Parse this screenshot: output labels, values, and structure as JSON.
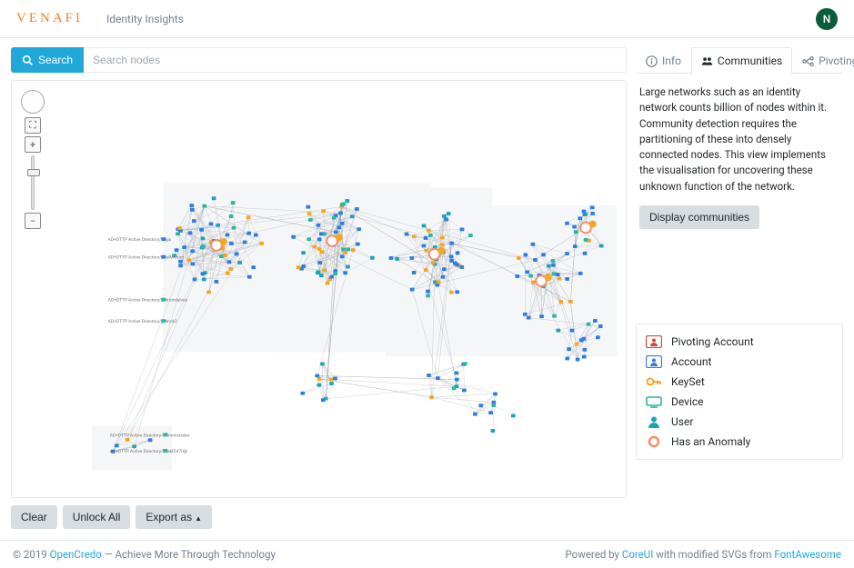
{
  "header": {
    "brand": "VENAFI",
    "subtitle": "Identity Insights",
    "avatar_initial": "N"
  },
  "search": {
    "button_label": "Search",
    "placeholder": "Search nodes"
  },
  "tabs": {
    "info": "Info",
    "communities": "Communities",
    "pivoting": "Pivoting",
    "active": "communities"
  },
  "panel": {
    "description": "Large networks such as an identity network counts billion of nodes within it. Community detection requires the partitioning of these into densely connected nodes. This view implements the visualisation for uncovering these unknown function of the network.",
    "display_btn": "Display communities"
  },
  "actions": {
    "clear": "Clear",
    "unlock": "Unlock All",
    "export": "Export as"
  },
  "legend": {
    "pivoting_account": "Pivoting Account",
    "account": "Account",
    "keyset": "KeySet",
    "device": "Device",
    "user": "User",
    "anomaly": "Has an Anomaly"
  },
  "footer": {
    "copyright_prefix": "© 2019 ",
    "copyright_link": "OpenCredo",
    "copyright_suffix": " — Achieve More Through Technology",
    "powered_prefix": "Powered by ",
    "powered_link1": "CoreUI",
    "powered_mid": " with modified SVGs from ",
    "powered_link2": "FontAwesome"
  },
  "graph": {
    "colors": {
      "account": "#2f7de1",
      "keyset": "#f5a623",
      "device": "#2bb5a0",
      "user": "#1fa2b8",
      "anomaly": "#f58f6b",
      "edge": "#9aa0a6",
      "label": "#6b7076"
    },
    "side_labels": [
      "AD+DTTP Active Directory/keyjs",
      "AD+DTTP Active Directory/paulMitford",
      "AD+DTTP Active Directory/patrickdalvist",
      "AD+DTTP Active Directory/patrick2",
      "AD+DTTP Active Directory/Administrator",
      "AD+DTTP Active Directory/kilakID470@"
    ]
  }
}
